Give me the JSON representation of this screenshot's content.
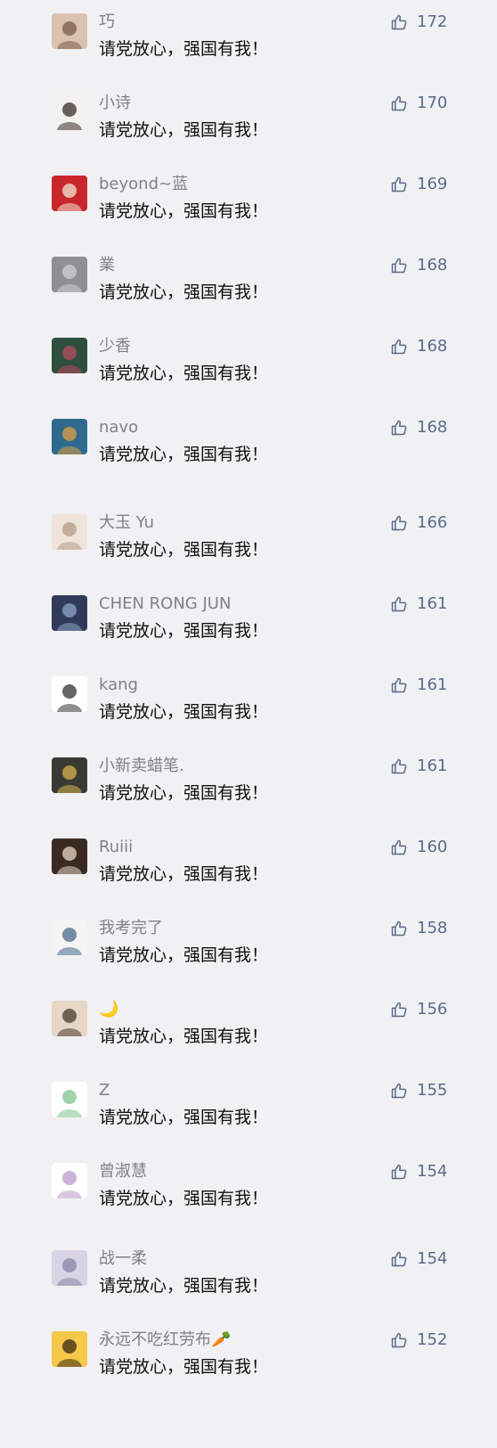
{
  "comments": [
    {
      "name": "巧",
      "text": "请党放心，强国有我！",
      "likes": "172",
      "avatar_colors": [
        "#d9c3b0",
        "#7a5a48"
      ]
    },
    {
      "name": "小诗",
      "text": "请党放心，强国有我！",
      "likes": "170",
      "avatar_colors": [
        "#f3f1ef",
        "#3a2e2a"
      ]
    },
    {
      "name": "beyond~蓝",
      "text": "请党放心，强国有我！",
      "likes": "169",
      "avatar_colors": [
        "#c9262b",
        "#f0e6d6"
      ]
    },
    {
      "name": "業",
      "text": "请党放心，强国有我！",
      "likes": "168",
      "avatar_colors": [
        "#8d8f93",
        "#cfd2d6"
      ]
    },
    {
      "name": "少香",
      "text": "请党放心，强国有我！",
      "likes": "168",
      "avatar_colors": [
        "#2f4f3e",
        "#b84b5c"
      ]
    },
    {
      "name": "navo",
      "text": "请党放心，强国有我！",
      "likes": "168",
      "avatar_colors": [
        "#2e6a8e",
        "#e0a040"
      ]
    },
    {
      "name": "大玉 Yu",
      "text": "请党放心，强国有我！",
      "likes": "166",
      "avatar_colors": [
        "#efe4da",
        "#b79a88"
      ]
    },
    {
      "name": "CHEN RONG JUN",
      "text": "请党放心，强国有我！",
      "likes": "161",
      "avatar_colors": [
        "#303a5a",
        "#8aa6c8"
      ]
    },
    {
      "name": "kang",
      "text": "请党放心，强国有我！",
      "likes": "161",
      "avatar_colors": [
        "#ffffff",
        "#333333"
      ]
    },
    {
      "name": "小新卖蜡笔.",
      "text": "请党放心，强国有我！",
      "likes": "161",
      "avatar_colors": [
        "#3a3a34",
        "#d8b24a"
      ]
    },
    {
      "name": "Ruiii",
      "text": "请党放心，强国有我！",
      "likes": "160",
      "avatar_colors": [
        "#3b2a22",
        "#e8d6c4"
      ]
    },
    {
      "name": "我考完了",
      "text": "请党放心，强国有我！",
      "likes": "158",
      "avatar_colors": [
        "#f4f4f4",
        "#4a6a8a"
      ]
    },
    {
      "name": "🌙",
      "text": "请党放心，强国有我！",
      "likes": "156",
      "avatar_colors": [
        "#e6d6c4",
        "#4a3a30"
      ]
    },
    {
      "name": "Z",
      "text": "请党放心，强国有我！",
      "likes": "155",
      "avatar_colors": [
        "#ffffff",
        "#7fc58e"
      ]
    },
    {
      "name": "曾淑慧",
      "text": "请党放心，强国有我！",
      "likes": "154",
      "avatar_colors": [
        "#ffffff",
        "#b99ac8"
      ]
    },
    {
      "name": "战一柔",
      "text": "请党放心，强国有我！",
      "likes": "154",
      "avatar_colors": [
        "#d8d4e6",
        "#8a84a8"
      ]
    },
    {
      "name": "永远不吃红劳布🥕",
      "text": "请党放心，强国有我！",
      "likes": "152",
      "avatar_colors": [
        "#f5c84a",
        "#3a2a10"
      ]
    }
  ],
  "icons": {
    "like": "thumbs-up-icon"
  },
  "colors": {
    "background": "#f1f1f3",
    "name": "#808086",
    "text": "#111111",
    "like": "#5a6a8a"
  }
}
